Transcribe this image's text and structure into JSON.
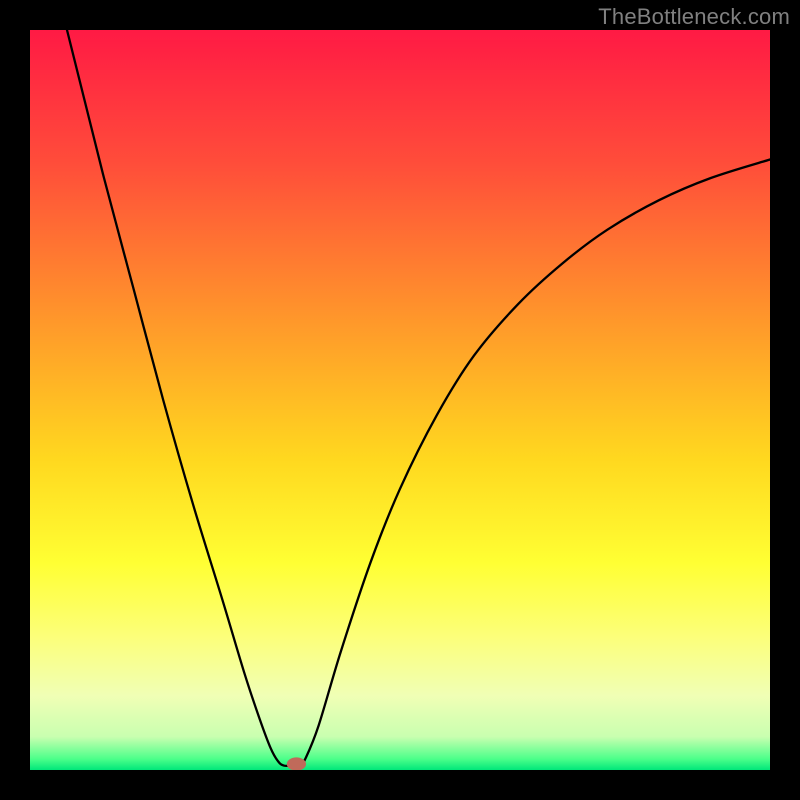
{
  "watermark": "TheBottleneck.com",
  "chart_data": {
    "type": "line",
    "title": "",
    "xlabel": "",
    "ylabel": "",
    "xlim": [
      0,
      100
    ],
    "ylim": [
      0,
      100
    ],
    "gradient_stops": [
      {
        "offset": 0.0,
        "color": "#ff1a44"
      },
      {
        "offset": 0.18,
        "color": "#ff4d3a"
      },
      {
        "offset": 0.4,
        "color": "#ff9a2a"
      },
      {
        "offset": 0.58,
        "color": "#ffd81f"
      },
      {
        "offset": 0.72,
        "color": "#ffff33"
      },
      {
        "offset": 0.82,
        "color": "#fcff7a"
      },
      {
        "offset": 0.9,
        "color": "#f0ffb5"
      },
      {
        "offset": 0.955,
        "color": "#c9ffb0"
      },
      {
        "offset": 0.985,
        "color": "#4cff8a"
      },
      {
        "offset": 1.0,
        "color": "#00e77a"
      }
    ],
    "series": [
      {
        "name": "bottleneck-curve",
        "color": "#000000",
        "width": 2.3,
        "points": [
          {
            "x": 5.0,
            "y": 100.0
          },
          {
            "x": 7.0,
            "y": 92.0
          },
          {
            "x": 10.0,
            "y": 80.0
          },
          {
            "x": 14.0,
            "y": 65.0
          },
          {
            "x": 18.0,
            "y": 50.0
          },
          {
            "x": 22.0,
            "y": 36.0
          },
          {
            "x": 26.0,
            "y": 23.0
          },
          {
            "x": 29.0,
            "y": 13.0
          },
          {
            "x": 31.0,
            "y": 7.0
          },
          {
            "x": 32.5,
            "y": 3.0
          },
          {
            "x": 33.5,
            "y": 1.2
          },
          {
            "x": 34.3,
            "y": 0.6
          },
          {
            "x": 35.5,
            "y": 0.6
          },
          {
            "x": 36.5,
            "y": 0.6
          },
          {
            "x": 37.2,
            "y": 1.5
          },
          {
            "x": 39.0,
            "y": 6.0
          },
          {
            "x": 42.0,
            "y": 16.0
          },
          {
            "x": 46.0,
            "y": 28.0
          },
          {
            "x": 50.0,
            "y": 38.0
          },
          {
            "x": 55.0,
            "y": 48.0
          },
          {
            "x": 60.0,
            "y": 56.0
          },
          {
            "x": 66.0,
            "y": 63.0
          },
          {
            "x": 72.0,
            "y": 68.5
          },
          {
            "x": 78.0,
            "y": 73.0
          },
          {
            "x": 85.0,
            "y": 77.0
          },
          {
            "x": 92.0,
            "y": 80.0
          },
          {
            "x": 100.0,
            "y": 82.5
          }
        ]
      }
    ],
    "marker": {
      "x": 36.0,
      "y": 0.8,
      "rx": 1.3,
      "ry": 0.9,
      "fill": "#c06a5a"
    }
  }
}
